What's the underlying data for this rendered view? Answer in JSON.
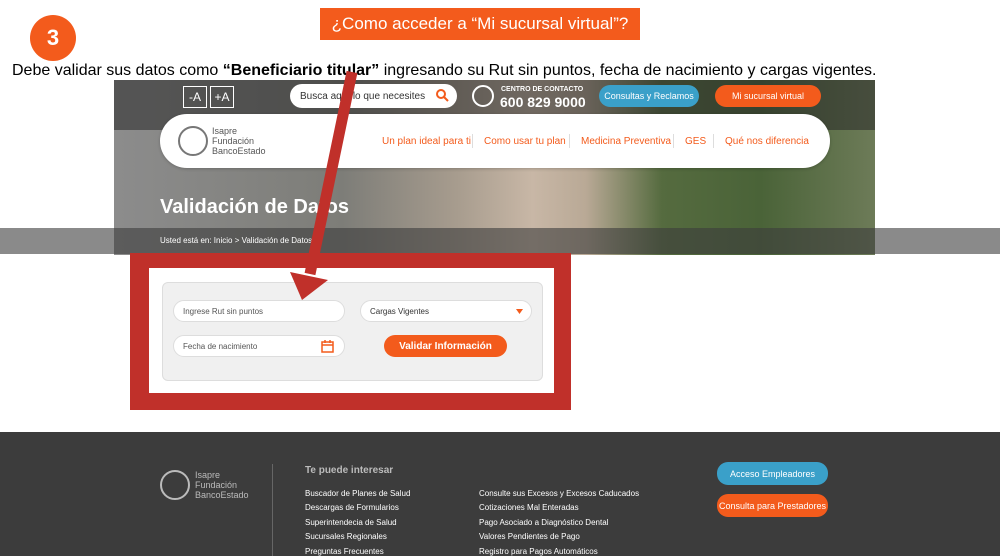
{
  "slide": {
    "title": "¿Como acceder a “Mi sucursal virtual”?",
    "step": "3",
    "instruction_prefix": "Debe validar sus datos como ",
    "instruction_bold": "“Beneficiario titular”",
    "instruction_suffix": " ingresando su Rut sin puntos, fecha de nacimiento y cargas vigentes."
  },
  "header": {
    "font_smaller": "-A",
    "font_larger": "+A",
    "search_placeholder": "Busca aquí lo que necesites",
    "contact_label": "CENTRO DE CONTACTO",
    "contact_phone": "600 829 9000",
    "btn_consultas": "Consultas y Reclamos",
    "btn_sucursal": "Mi sucursal virtual"
  },
  "brand": {
    "line1": "Isapre",
    "line2": "Fundación",
    "line3": "BancoEstado"
  },
  "nav": {
    "items": [
      "Un plan ideal para ti",
      "Como usar tu plan",
      "Medicina Preventiva",
      "GES",
      "Qué nos diferencia"
    ]
  },
  "hero": {
    "heading": "Validación de Datos",
    "breadcrumb": "Usted está en: Inicio > Validación de Datos"
  },
  "form": {
    "rut_placeholder": "Ingrese Rut sin puntos",
    "cargas_selected": "Cargas Vigentes",
    "fecha_placeholder": "Fecha de nacimiento",
    "submit_label": "Validar Información"
  },
  "footer": {
    "heading": "Te puede interesar",
    "col1": [
      "Buscador de Planes de Salud",
      "Descargas de Formularios",
      "Superintendecia de Salud",
      "Sucursales Regionales",
      "Preguntas Frecuentes"
    ],
    "col2": [
      "Consulte sus Excesos y Excesos Caducados",
      "Cotizaciones Mal Enteradas",
      "Pago Asociado a Diagnóstico Dental",
      "Valores Pendientes de Pago",
      "Registro para Pagos Automáticos"
    ],
    "btn_empleadores": "Acceso Empleadores",
    "btn_prestadores": "Consulta para Prestadores"
  },
  "colors": {
    "accent": "#f35b1c",
    "blue": "#3aa0c9",
    "frame_red": "#c0302a",
    "footer_bg": "#3c3c3c"
  },
  "icons": {
    "search": "search-icon",
    "phone": "phone-icon",
    "calendar": "calendar-icon",
    "dropdown": "caret-down-icon"
  }
}
